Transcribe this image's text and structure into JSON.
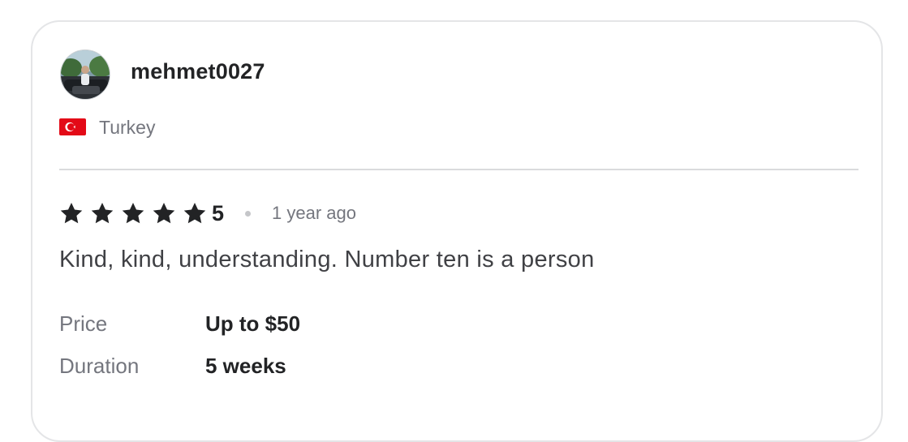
{
  "review": {
    "username": "mehmet0027",
    "country": "Turkey",
    "flag_icon": "turkey-flag-icon",
    "rating_stars": 5,
    "rating_value": "5",
    "time_ago": "1 year ago",
    "text": "Kind, kind, understanding. Number ten is a person",
    "details": {
      "price_label": "Price",
      "price_value": "Up to $50",
      "duration_label": "Duration",
      "duration_value": "5 weeks"
    }
  },
  "colors": {
    "star": "#222325",
    "flag_red": "#e30a17",
    "muted_text": "#74767e",
    "border": "#e4e5e7"
  }
}
